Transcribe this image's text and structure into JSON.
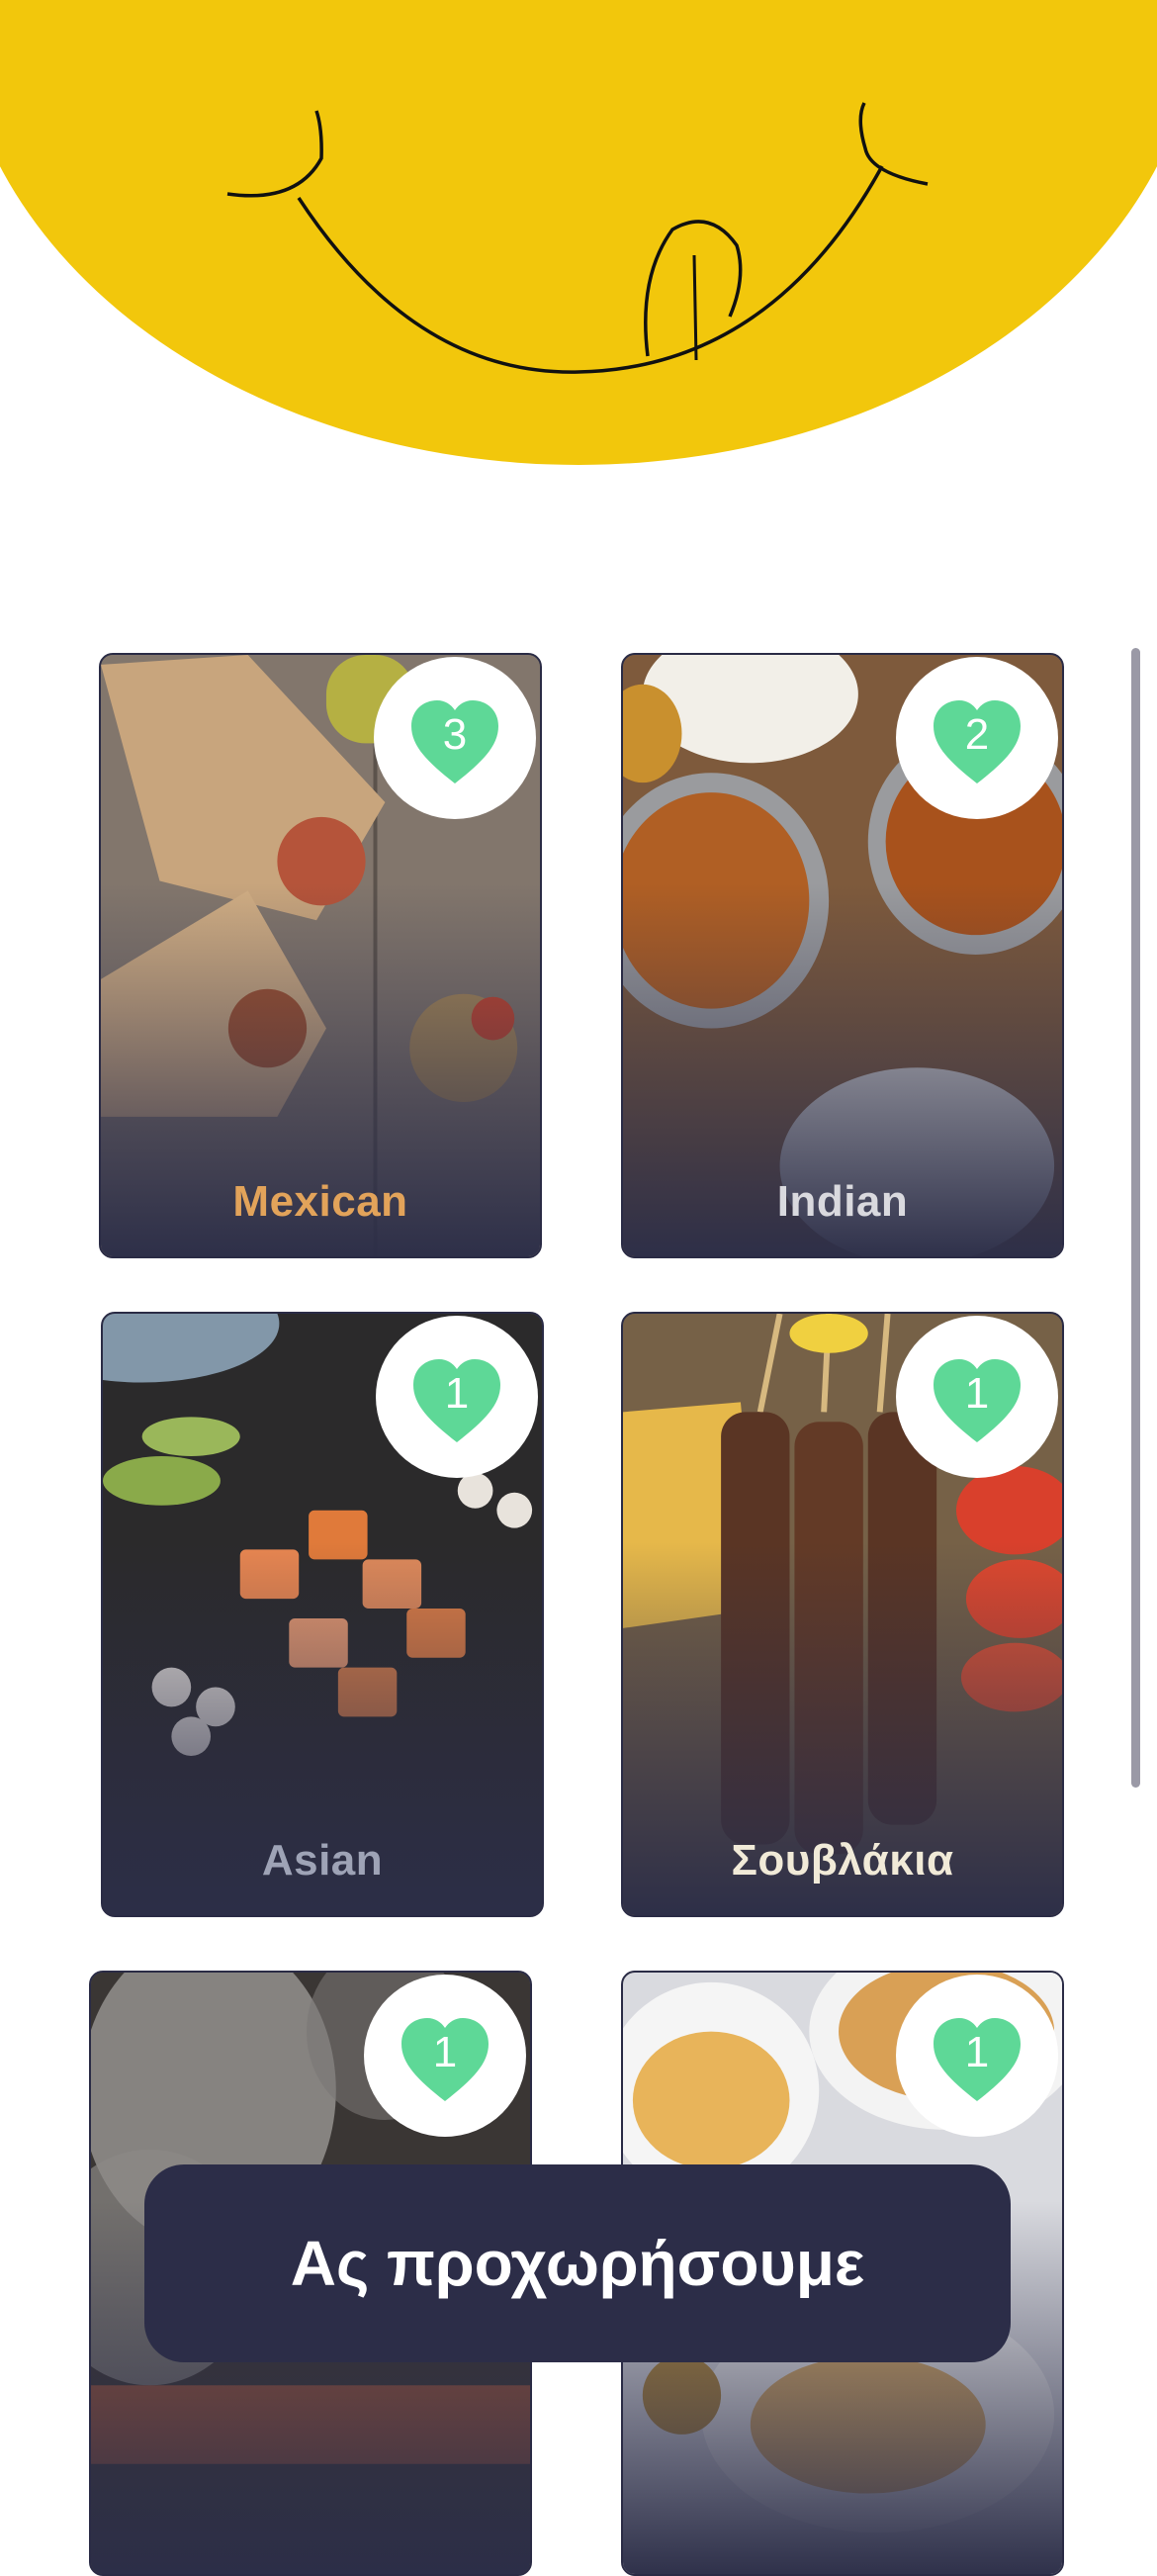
{
  "colors": {
    "yellow": "#f2c70c",
    "heart": "#5ed897",
    "dark": "#2c2d48"
  },
  "cards": [
    {
      "name": "Mexican",
      "likes": "3",
      "label_color": "#e2a35a"
    },
    {
      "name": "Indian",
      "likes": "2",
      "label_color": "#d9d9de"
    },
    {
      "name": "Asian",
      "likes": "1",
      "label_color": "#9ea3b6"
    },
    {
      "name": "Σουβλάκια",
      "likes": "1",
      "label_color": "#f1ead8"
    },
    {
      "name": "",
      "likes": "1",
      "label_color": "#ffffff"
    },
    {
      "name": "",
      "likes": "1",
      "label_color": "#ffffff"
    }
  ],
  "proceed_label": "Ας προχωρήσουμε"
}
